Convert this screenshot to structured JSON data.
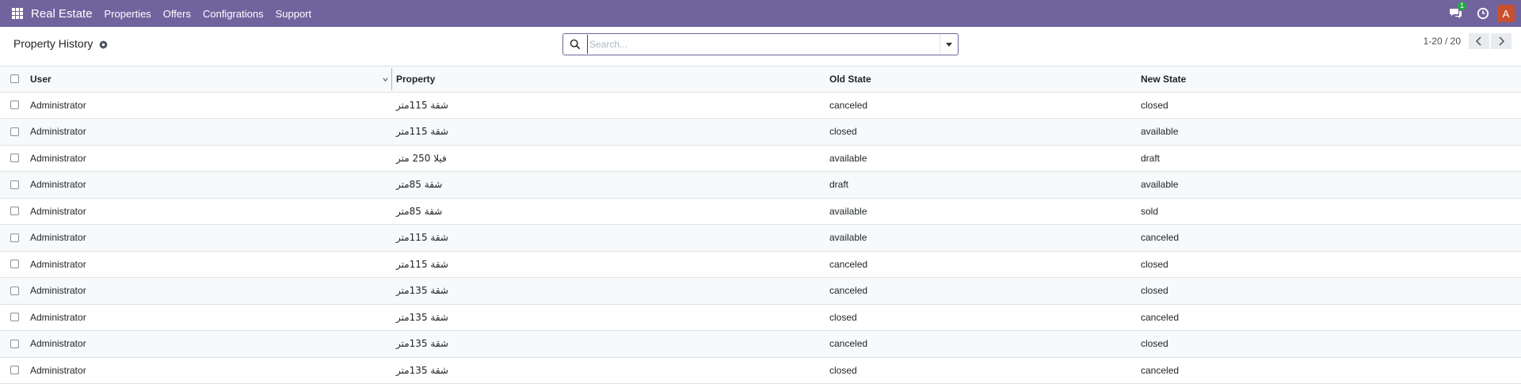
{
  "navbar": {
    "brand": "Real Estate",
    "menu": [
      "Properties",
      "Offers",
      "Configrations",
      "Support"
    ],
    "chat_badge": "1",
    "avatar_letter": "A",
    "bg_color": "#71639e"
  },
  "control_panel": {
    "title": "Property History",
    "search_placeholder": "Search...",
    "pager": "1-20 / 20"
  },
  "table": {
    "headers": {
      "user": "User",
      "property": "Property",
      "old_state": "Old State",
      "new_state": "New State"
    },
    "rows": [
      {
        "user": "Administrator",
        "property": "شقة 115متر",
        "old_state": "canceled",
        "new_state": "closed"
      },
      {
        "user": "Administrator",
        "property": "شقة 115متر",
        "old_state": "closed",
        "new_state": "available"
      },
      {
        "user": "Administrator",
        "property": "فيلا 250 متر",
        "old_state": "available",
        "new_state": "draft"
      },
      {
        "user": "Administrator",
        "property": "شقة 85متر",
        "old_state": "draft",
        "new_state": "available"
      },
      {
        "user": "Administrator",
        "property": "شقة 85متر",
        "old_state": "available",
        "new_state": "sold"
      },
      {
        "user": "Administrator",
        "property": "شقة 115متر",
        "old_state": "available",
        "new_state": "canceled"
      },
      {
        "user": "Administrator",
        "property": "شقة 115متر",
        "old_state": "canceled",
        "new_state": "closed"
      },
      {
        "user": "Administrator",
        "property": "شقة 135متر",
        "old_state": "canceled",
        "new_state": "closed"
      },
      {
        "user": "Administrator",
        "property": "شقة 135متر",
        "old_state": "closed",
        "new_state": "canceled"
      },
      {
        "user": "Administrator",
        "property": "شقة 135متر",
        "old_state": "canceled",
        "new_state": "closed"
      },
      {
        "user": "Administrator",
        "property": "شقة 135متر",
        "old_state": "closed",
        "new_state": "canceled"
      }
    ]
  }
}
